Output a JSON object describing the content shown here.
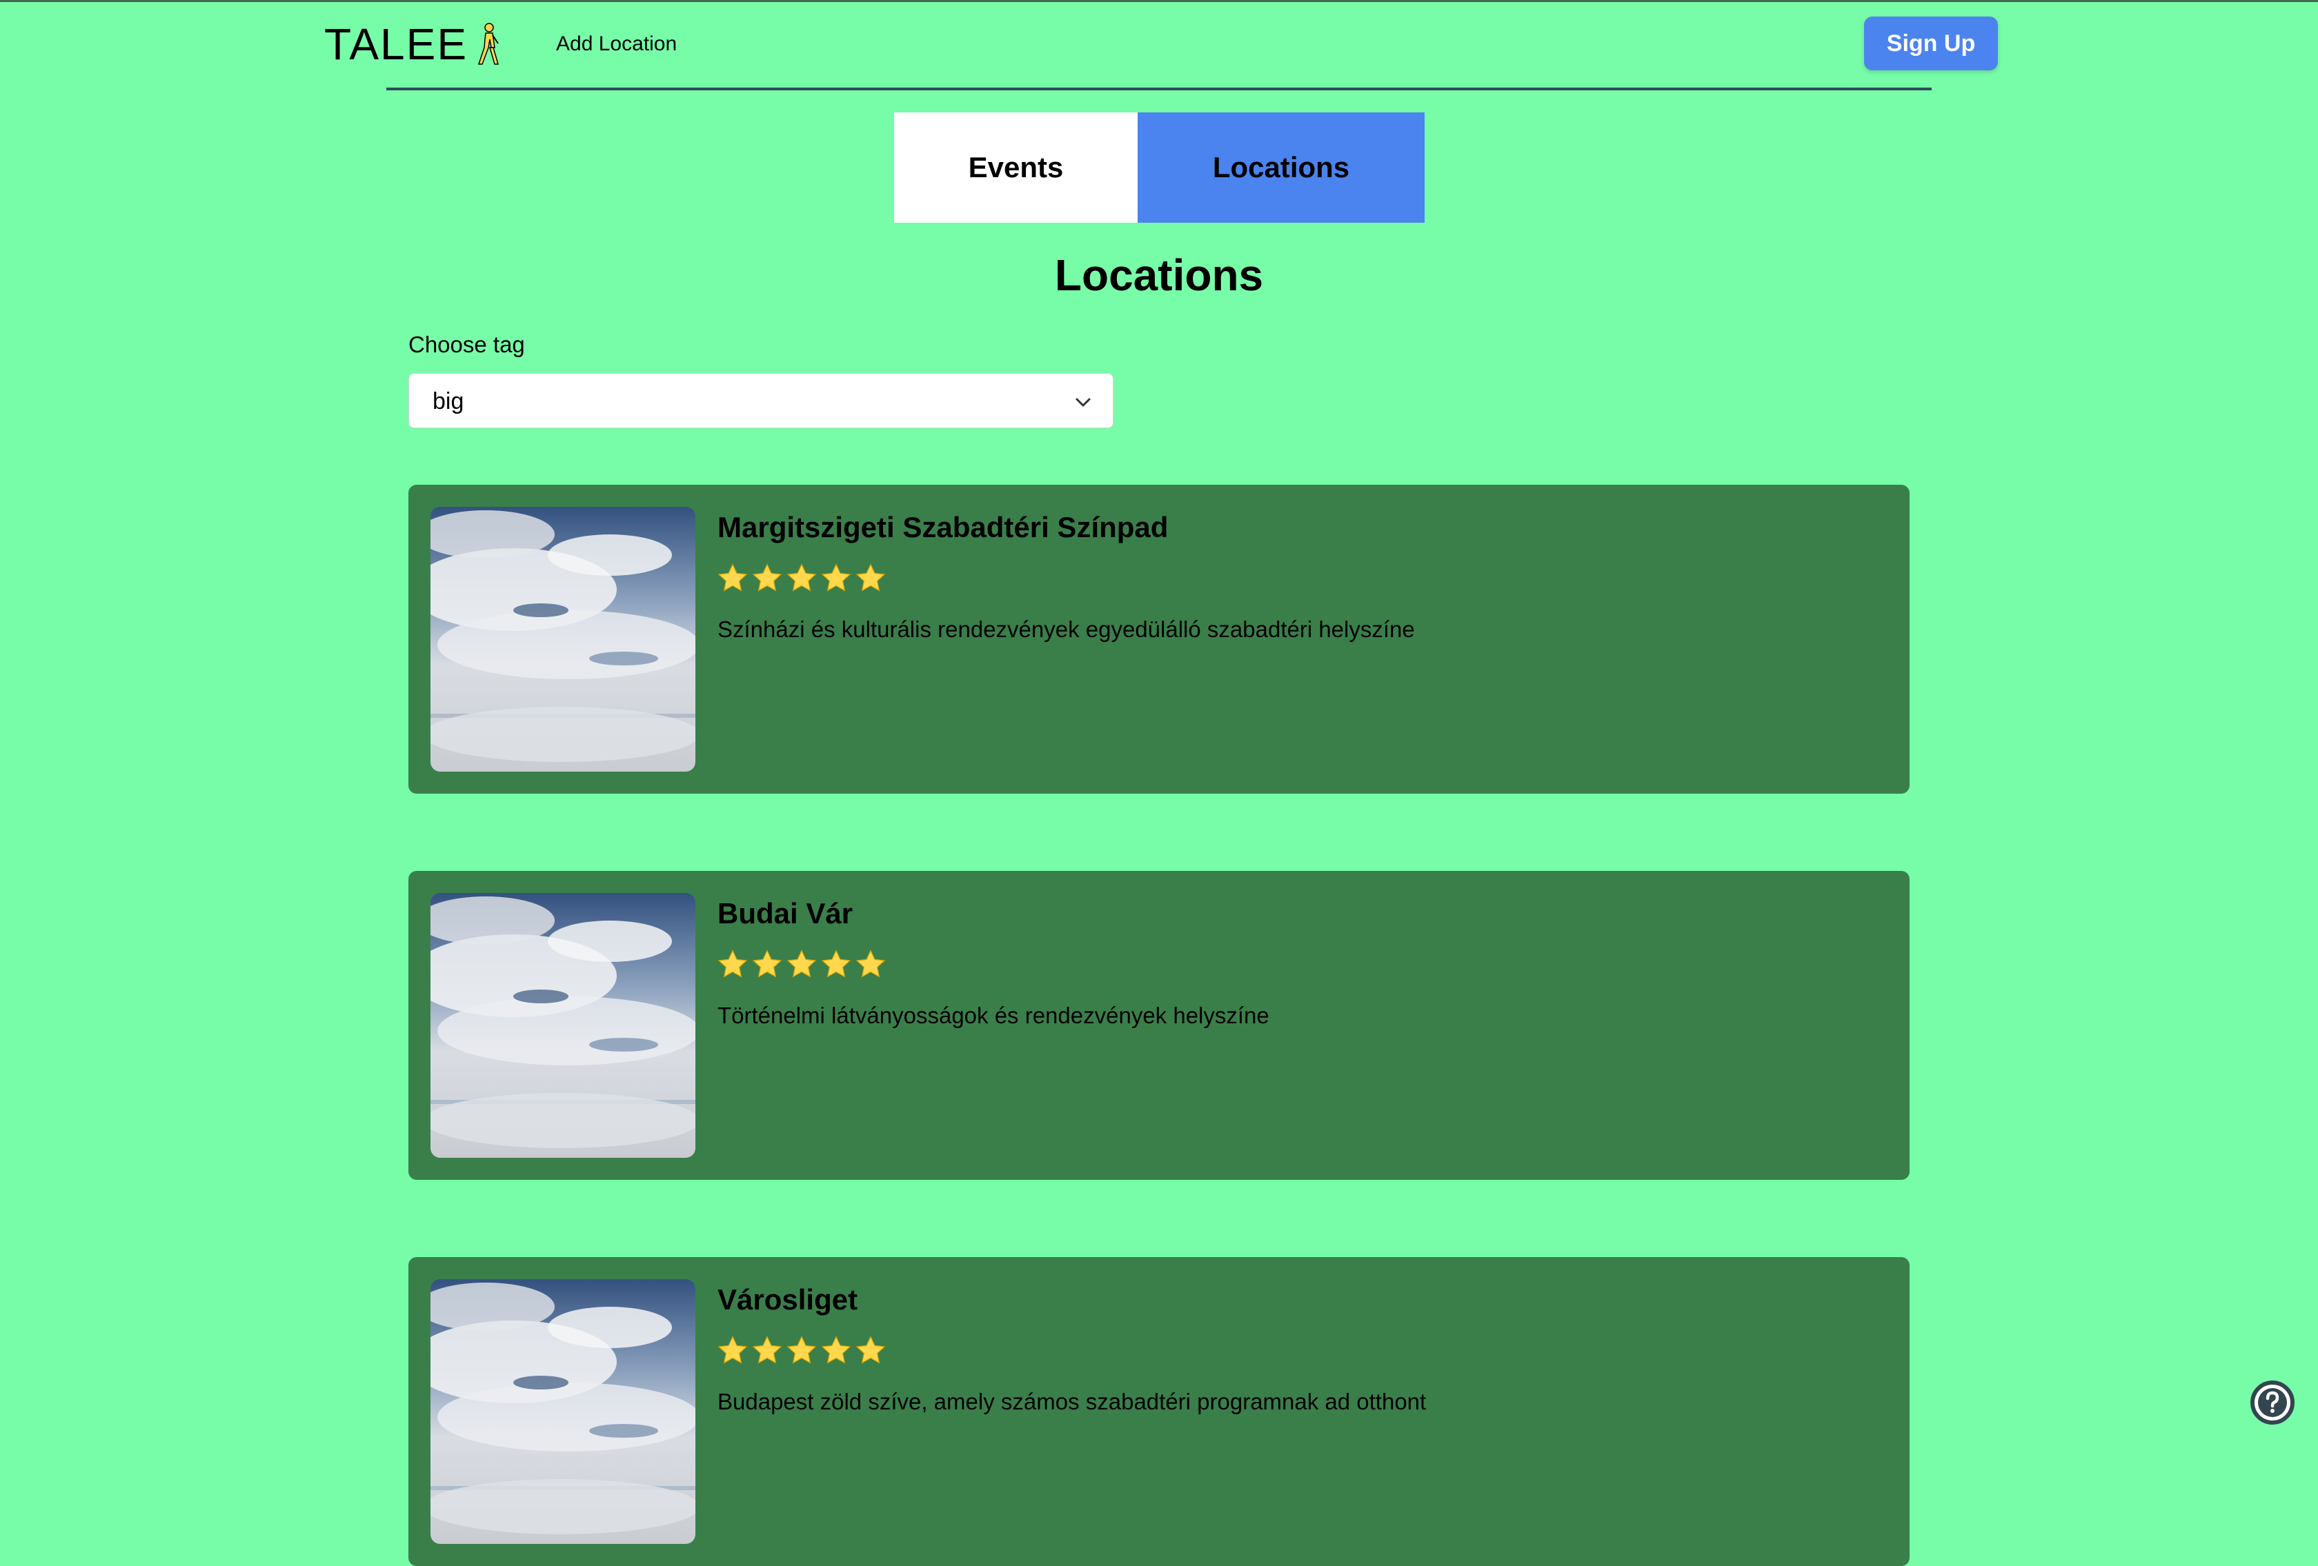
{
  "colors": {
    "page_background": "#77fca8",
    "accent_blue": "#4b84ef",
    "card_green": "#3a7f4a",
    "star_yellow": "#ffd84d"
  },
  "header": {
    "logo_text": "TALEE",
    "add_location_label": "Add Location",
    "signup_label": "Sign Up"
  },
  "tabs": [
    {
      "label": "Events",
      "active": false
    },
    {
      "label": "Locations",
      "active": true
    }
  ],
  "page_title": "Locations",
  "tag_filter": {
    "label": "Choose tag",
    "selected": "big"
  },
  "locations": [
    {
      "name": "Margitszigeti Szabadtéri Színpad",
      "rating": 5,
      "description": "Színházi és kulturális rendezvények egyedülálló szabadtéri helyszíne"
    },
    {
      "name": "Budai Vár",
      "rating": 5,
      "description": "Történelmi látványosságok és rendezvények helyszíne"
    },
    {
      "name": "Városliget",
      "rating": 5,
      "description": "Budapest zöld szíve, amely számos szabadtéri programnak ad otthont"
    }
  ]
}
